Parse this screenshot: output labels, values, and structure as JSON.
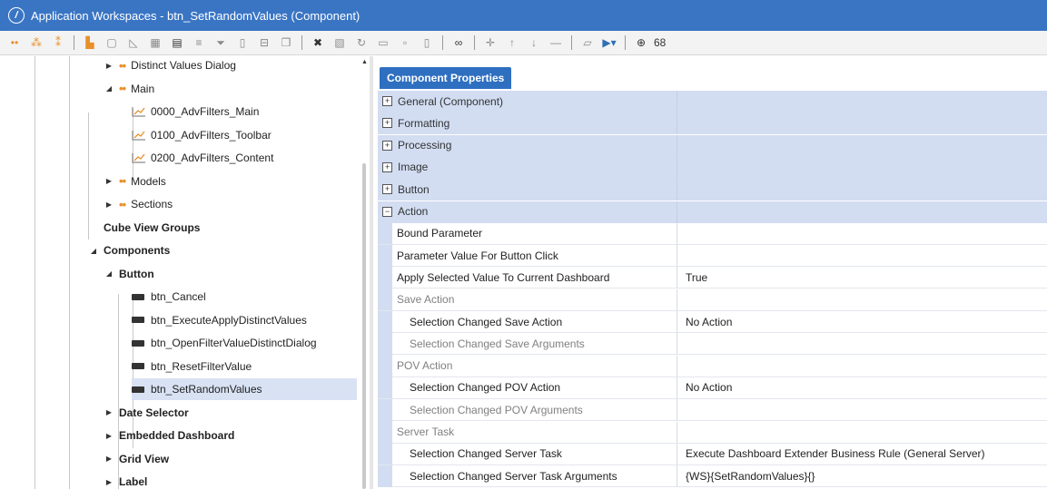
{
  "window": {
    "title": "Application Workspaces - btn_SetRandomValues (Component)",
    "icon": "app-logo-icon"
  },
  "toolbar": {
    "trailing_text": "68"
  },
  "tree": {
    "items": [
      {
        "label": "Distinct Values Dialog",
        "level": 2,
        "expanded": false,
        "icon": "group-dots-icon"
      },
      {
        "label": "Main",
        "level": 2,
        "expanded": true,
        "icon": "group-dots-icon"
      },
      {
        "label": "0000_AdvFilters_Main",
        "level": 3,
        "icon": "dashboard-chart-icon"
      },
      {
        "label": "0100_AdvFilters_Toolbar",
        "level": 3,
        "icon": "dashboard-chart-icon"
      },
      {
        "label": "0200_AdvFilters_Content",
        "level": 3,
        "icon": "dashboard-chart-icon"
      },
      {
        "label": "Models",
        "level": 2,
        "expanded": false,
        "icon": "group-dots-icon"
      },
      {
        "label": "Sections",
        "level": 2,
        "expanded": false,
        "icon": "group-dots-icon"
      },
      {
        "label": "Cube View Groups",
        "level": 1,
        "bold": true
      },
      {
        "label": "Components",
        "level": 1,
        "bold": true,
        "expanded": true
      },
      {
        "label": "Button",
        "level": 2,
        "bold": true,
        "expanded": true
      },
      {
        "label": "btn_Cancel",
        "level": 3,
        "icon": "button-component-icon"
      },
      {
        "label": "btn_ExecuteApplyDistinctValues",
        "level": 3,
        "icon": "button-component-icon"
      },
      {
        "label": "btn_OpenFilterValueDistinctDialog",
        "level": 3,
        "icon": "button-component-icon"
      },
      {
        "label": "btn_ResetFilterValue",
        "level": 3,
        "icon": "button-component-icon"
      },
      {
        "label": "btn_SetRandomValues",
        "level": 3,
        "icon": "button-component-icon",
        "selected": true
      },
      {
        "label": "Date Selector",
        "level": 2,
        "bold": true,
        "expanded": false
      },
      {
        "label": "Embedded Dashboard",
        "level": 2,
        "bold": true,
        "expanded": false
      },
      {
        "label": "Grid View",
        "level": 2,
        "bold": true,
        "expanded": false
      },
      {
        "label": "Label",
        "level": 2,
        "bold": true,
        "expanded": false
      }
    ]
  },
  "properties": {
    "tab_label": "Component Properties",
    "rows": [
      {
        "kind": "cat",
        "label": "General (Component)",
        "expander": "⊞"
      },
      {
        "kind": "cat",
        "label": "Formatting",
        "expander": "⊞"
      },
      {
        "kind": "cat",
        "label": "Processing",
        "expander": "⊞"
      },
      {
        "kind": "cat",
        "label": "Image",
        "expander": "⊞"
      },
      {
        "kind": "cat",
        "label": "Button",
        "expander": "⊞"
      },
      {
        "kind": "cat",
        "label": "Action",
        "expander": "⊟"
      },
      {
        "kind": "prop",
        "label": "Bound Parameter",
        "value": ""
      },
      {
        "kind": "prop",
        "label": "Parameter Value For Button Click",
        "value": ""
      },
      {
        "kind": "prop",
        "label": "Apply Selected Value To Current Dashboard",
        "value": "True"
      },
      {
        "kind": "sub",
        "label": "Save Action"
      },
      {
        "kind": "prop2",
        "label": "Selection Changed Save Action",
        "value": "No Action"
      },
      {
        "kind": "prop2",
        "label": "Selection Changed Save Arguments",
        "value": "",
        "dimmed": true
      },
      {
        "kind": "sub",
        "label": "POV Action"
      },
      {
        "kind": "prop2",
        "label": "Selection Changed POV Action",
        "value": "No Action"
      },
      {
        "kind": "prop2",
        "label": "Selection Changed POV Arguments",
        "value": "",
        "dimmed": true
      },
      {
        "kind": "sub",
        "label": "Server Task"
      },
      {
        "kind": "prop2",
        "label": "Selection Changed Server Task",
        "value": "Execute Dashboard Extender Business Rule (General Server)"
      },
      {
        "kind": "prop2",
        "label": "Selection Changed Server Task Arguments",
        "value": "{WS}{SetRandomValues}{}"
      }
    ]
  },
  "colors": {
    "titlebar": "#3a75c4",
    "tab": "#2e6fc0",
    "category_row": "#d2ddf2",
    "selected_tree_row": "#d8e2f3"
  }
}
